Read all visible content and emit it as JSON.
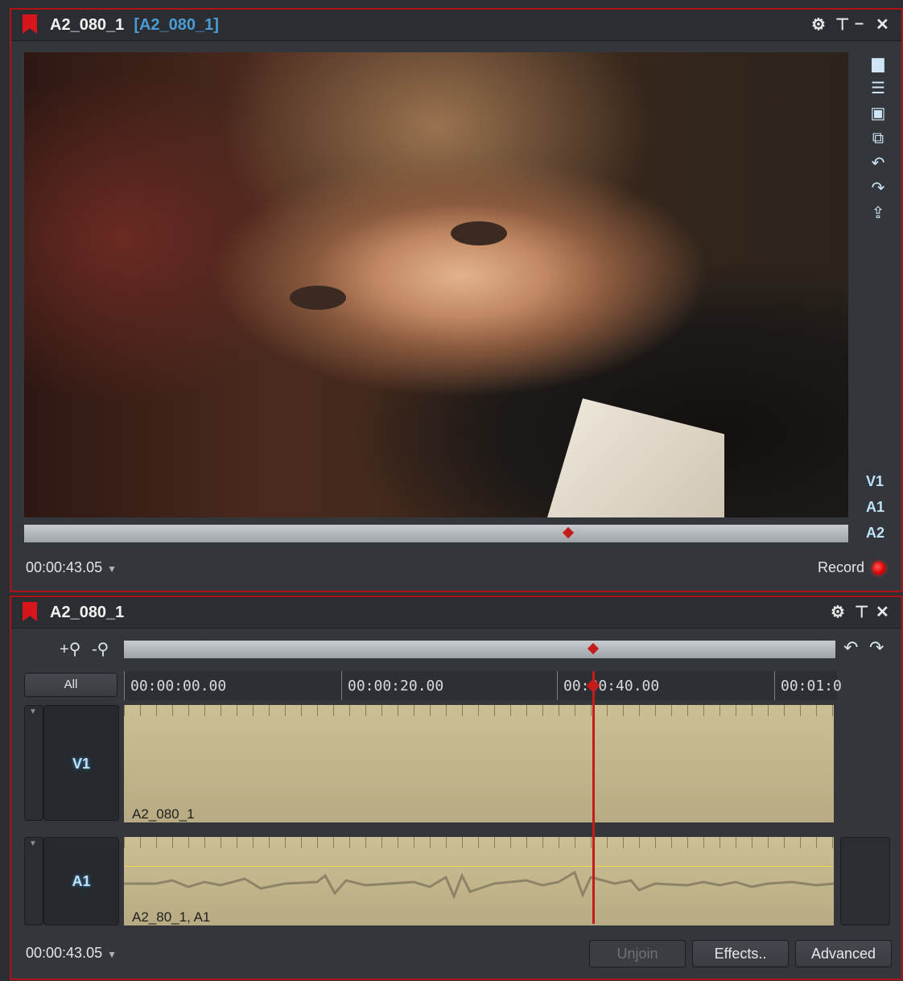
{
  "viewer": {
    "title": "A2_080_1",
    "subtitle": "[A2_080_1]",
    "timecode": "00:00:43.05",
    "record_label": "Record",
    "tracks": [
      "V1",
      "A1",
      "A2"
    ],
    "scrubber_position": 0.66
  },
  "editor": {
    "title": "A2_080_1",
    "timecode": "00:00:43.05",
    "zoom_in_label": "+",
    "zoom_out_label": "-",
    "all_label": "All",
    "ruler": [
      "00:00:00.00",
      "00:00:20.00",
      "00:00:40.00",
      "00:01:0"
    ],
    "playhead_position": 0.66,
    "tracks": [
      {
        "name": "V1",
        "clip": "A2_080_1"
      },
      {
        "name": "A1",
        "clip": "A2_80_1, A1"
      }
    ],
    "buttons": {
      "unjoin": "Unjoin",
      "effects": "Effects..",
      "advanced": "Advanced"
    }
  },
  "colors": {
    "accent": "#b01217",
    "track_label": "#bfe2f8",
    "clip": "#c9bb90",
    "playhead": "#c41b1b"
  }
}
